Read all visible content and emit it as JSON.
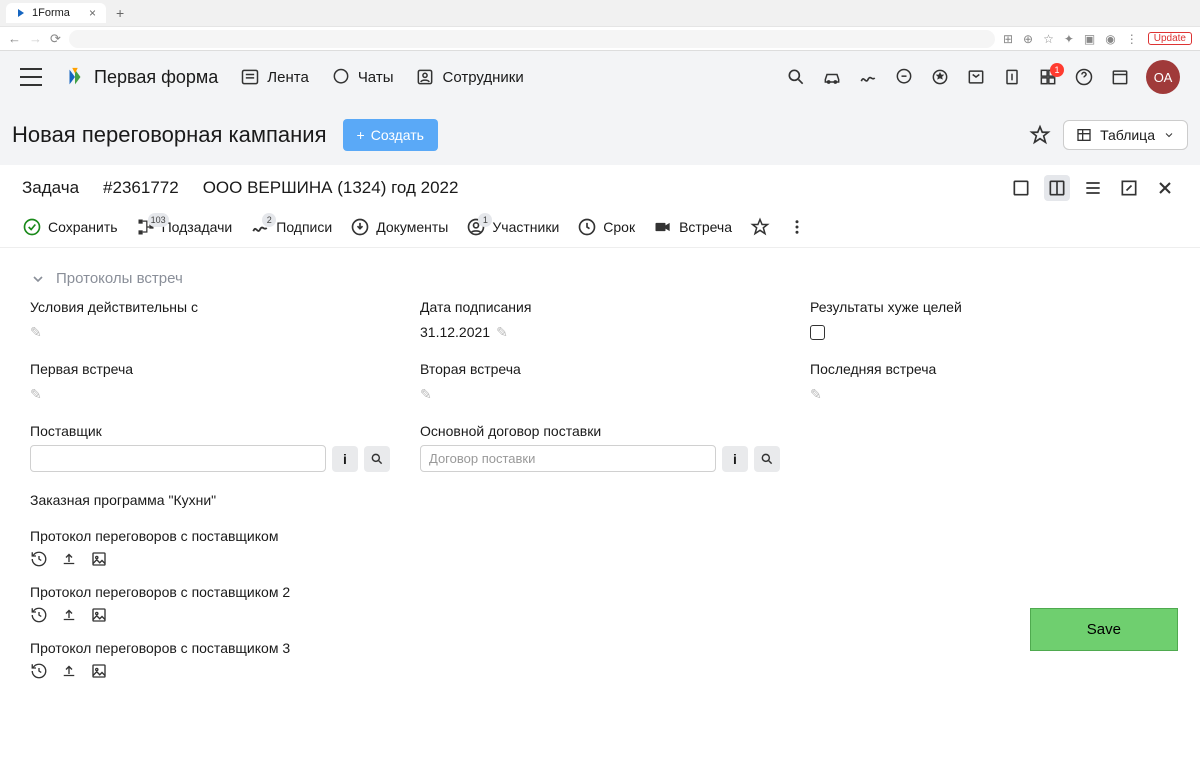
{
  "browser": {
    "tab_title": "1Forma",
    "update_label": "Update"
  },
  "header": {
    "app_name": "Первая форма",
    "nav": {
      "feed": "Лента",
      "chats": "Чаты",
      "employees": "Сотрудники"
    },
    "badge_count": "1",
    "avatar_initials": "ОА"
  },
  "page": {
    "title": "Новая переговорная кампания",
    "create_label": "Создать",
    "view_label": "Таблица"
  },
  "task": {
    "label": "Задача",
    "id": "#2361772",
    "name": "ООО ВЕРШИНА (1324) год 2022"
  },
  "actions": {
    "save": "Сохранить",
    "subtasks": {
      "label": "Подзадачи",
      "count": "103"
    },
    "signatures": {
      "label": "Подписи",
      "count": "2"
    },
    "documents": "Документы",
    "participants": {
      "label": "Участники",
      "count": "1"
    },
    "deadline": "Срок",
    "meeting": "Встреча"
  },
  "section": {
    "protocols_title": "Протоколы встреч"
  },
  "fields": {
    "valid_from": "Условия действительны с",
    "sign_date_label": "Дата подписания",
    "sign_date_value": "31.12.2021",
    "results_worse": "Результаты хуже целей",
    "first_meeting": "Первая встреча",
    "second_meeting": "Вторая встреча",
    "last_meeting": "Последняя встреча",
    "supplier": "Поставщик",
    "main_contract": "Основной договор поставки",
    "contract_placeholder": "Договор поставки",
    "custom_program": "Заказная программа \"Кухни\""
  },
  "files": {
    "p1": "Протокол переговоров с поставщиком",
    "p2": "Протокол переговоров с поставщиком 2",
    "p3": "Протокол переговоров с поставщиком 3"
  },
  "save_button": "Save"
}
